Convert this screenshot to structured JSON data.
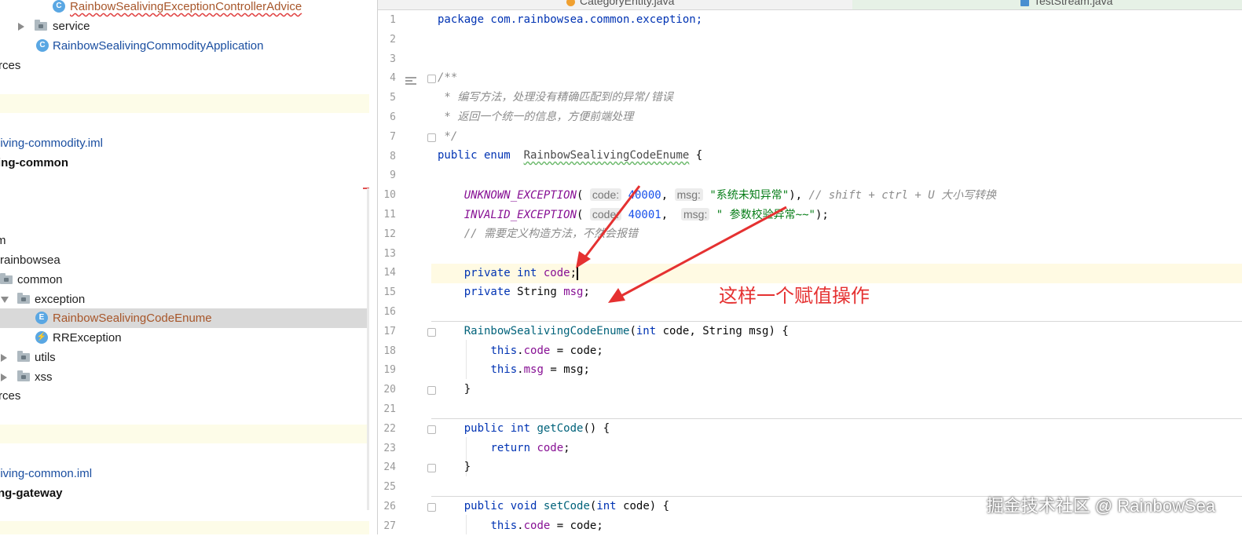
{
  "project_tree": {
    "rows": [
      {
        "label": "RainbowSealivingExceptionControllerAdvice",
        "icon": "class-icon",
        "icon_letter": "C"
      },
      {
        "label": "service",
        "icon": "folder-icon"
      },
      {
        "label": "RainbowSealivingCommodityApplication",
        "icon": "spring-app-icon",
        "icon_letter": "C"
      },
      {
        "label": "rces"
      },
      {
        "label": "living-commodity.iml"
      },
      {
        "label": "ing-common"
      },
      {
        "label": "m"
      },
      {
        "label": "rainbowsea"
      },
      {
        "label": "common",
        "icon": "folder-icon"
      },
      {
        "label": "exception",
        "icon": "folder-icon"
      },
      {
        "label": "RainbowSealivingCodeEnume",
        "icon": "enum-icon",
        "icon_letter": "E"
      },
      {
        "label": "RRException",
        "icon": "exception-class-icon",
        "icon_letter": "⚡"
      },
      {
        "label": "utils",
        "icon": "folder-icon"
      },
      {
        "label": "xss",
        "icon": "folder-icon"
      },
      {
        "label": "rces"
      },
      {
        "label": "living-common.iml"
      },
      {
        "label": "ng-gateway"
      }
    ]
  },
  "tabs": [
    {
      "label": "CategoryEntity.java"
    },
    {
      "label": "TestStream.java"
    }
  ],
  "editor": {
    "line_numbers": [
      "1",
      "2",
      "3",
      "4",
      "5",
      "6",
      "7",
      "8",
      "9",
      "10",
      "11",
      "12",
      "13",
      "14",
      "15",
      "16",
      "17",
      "18",
      "19",
      "20",
      "21",
      "22",
      "23",
      "24",
      "25",
      "26",
      "27"
    ],
    "code": {
      "l1": "package com.rainbowsea.common.exception;",
      "l4": "/**",
      "l5": " * 编写方法，处理没有精确匹配到的异常/错误",
      "l6": " * 返回一个统一的信息，方便前端处理",
      "l7": " */",
      "l8_kw": "public enum",
      "l8_name": "RainbowSealivingCodeEnume",
      "l8_end": " {",
      "l10_name": "UNKNOWN_EXCEPTION",
      "l10_hint1": "code:",
      "l10_num": "40000",
      "l10_hint2": "msg:",
      "l10_str": "\"系统未知异常\"",
      "l10_comment": "// shift + ctrl + U 大小写转换",
      "l11_name": "INVALID_EXCEPTION",
      "l11_hint1": "code:",
      "l11_num": "40001",
      "l11_hint2": "msg:",
      "l11_str": "\" 参数校验异常~~\"",
      "l12": "// 需要定义构造方法，不然会报错",
      "l14_kw": "private int",
      "l14_field": "code",
      "l15_kw": "private",
      "l15_type": "String",
      "l15_field": "msg",
      "l17_name": "RainbowSealivingCodeEnume",
      "l17_kw1": "int",
      "l17_p1": "code",
      "l17_type": "String",
      "l17_p2": "msg",
      "l18_kw": "this",
      "l18_field": "code",
      "l18_rhs": "code",
      "l19_kw": "this",
      "l19_field": "msg",
      "l19_rhs": "msg",
      "l20": "}",
      "l22_kw": "public int",
      "l22_fn": "getCode",
      "l23_kw": "return",
      "l23_field": "code",
      "l24": "}",
      "l26_kw": "public void",
      "l26_fn": "setCode",
      "l26_kw2": "int",
      "l26_p": "code",
      "l27_kw": "this",
      "l27_field": "code",
      "l27_rhs": "code"
    }
  },
  "annotation_text": "这样一个赋值操作",
  "watermark": "掘金技术社区 @ RainbowSea",
  "colors": {
    "keyword": "#0033b3",
    "enum_constant": "#871094",
    "string": "#067d17",
    "number": "#1750eb",
    "comment": "#8c8c8c",
    "annotation_red": "#e53131",
    "selected_row": "#d9d9d9",
    "current_line": "#fffae3"
  }
}
